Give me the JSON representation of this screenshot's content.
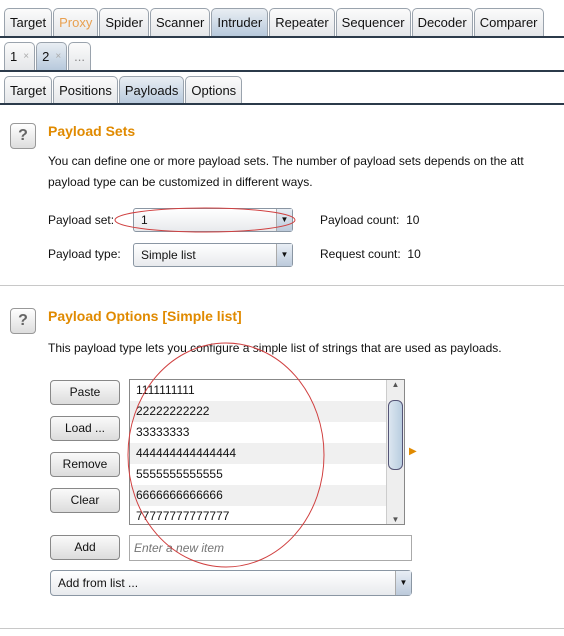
{
  "main_tabs": [
    {
      "label": "Target"
    },
    {
      "label": "Proxy",
      "color": "#e8a050"
    },
    {
      "label": "Spider"
    },
    {
      "label": "Scanner"
    },
    {
      "label": "Intruder",
      "selected": true
    },
    {
      "label": "Repeater"
    },
    {
      "label": "Sequencer"
    },
    {
      "label": "Decoder"
    },
    {
      "label": "Comparer"
    }
  ],
  "attack_tabs": [
    {
      "label": "1",
      "close": "×"
    },
    {
      "label": "2",
      "close": "×",
      "selected": true
    },
    {
      "label": "..."
    }
  ],
  "intruder_tabs": [
    {
      "label": "Target"
    },
    {
      "label": "Positions"
    },
    {
      "label": "Payloads",
      "selected": true
    },
    {
      "label": "Options"
    }
  ],
  "payload_sets": {
    "help": "?",
    "title": "Payload Sets",
    "desc1": "You can define one or more payload sets. The number of payload sets depends on the att",
    "desc2": "payload type can be customized in different ways.",
    "set_label": "Payload set:",
    "set_value": "1",
    "type_label": "Payload type:",
    "type_value": "Simple list",
    "count_label": "Payload count:",
    "count_value": "10",
    "request_label": "Request count:",
    "request_value": "10"
  },
  "payload_options": {
    "help": "?",
    "title": "Payload Options [Simple list]",
    "desc": "This payload type lets you configure a simple list of strings that are used as payloads.",
    "buttons": {
      "paste": "Paste",
      "load": "Load ...",
      "remove": "Remove",
      "clear": "Clear",
      "add": "Add"
    },
    "items": [
      "1111111111",
      "22222222222",
      "33333333",
      "444444444444444",
      "5555555555555",
      "6666666666666",
      "77777777777777"
    ],
    "new_item_placeholder": "Enter a new item",
    "add_from_list": "Add from list ..."
  },
  "annotation_color": "#d04040"
}
